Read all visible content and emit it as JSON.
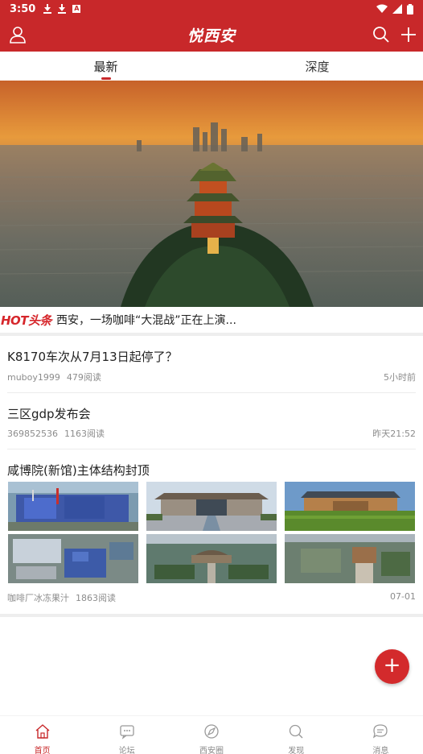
{
  "status_bar": {
    "time": "3:50",
    "battery_level": 0.9
  },
  "header": {
    "title": "悦西安",
    "icons": [
      "user-icon",
      "search-icon",
      "plus-icon"
    ],
    "color": "#c8282a"
  },
  "tabs": [
    {
      "label": "最新",
      "active": true
    },
    {
      "label": "深度",
      "active": false
    }
  ],
  "hot": {
    "tag": "HOT头条",
    "headline": "西安，一场咖啡“大混战”正在上演..."
  },
  "news": [
    {
      "title": "K8170车次从7月13日起停了？",
      "author": "muboy1999",
      "reads": "479阅读",
      "time": "5小时前"
    },
    {
      "title": "三区gdp发布会",
      "author": "369852536",
      "reads": "1163阅读",
      "time": "昨天21:52"
    },
    {
      "title": "咸博院(新馆)主体结构封顶",
      "author": "咖啡厂冰冻果汁",
      "reads": "1863阅读",
      "time": "07-01"
    }
  ],
  "fab": {
    "label": "+"
  },
  "bottom_nav": [
    {
      "label": "首页",
      "icon": "home-icon",
      "active": true
    },
    {
      "label": "论坛",
      "icon": "chat-icon",
      "active": false
    },
    {
      "label": "西安圈",
      "icon": "compass-icon",
      "active": false
    },
    {
      "label": "发现",
      "icon": "search-icon",
      "active": false
    },
    {
      "label": "消息",
      "icon": "message-icon",
      "active": false
    }
  ],
  "accent_color": "#c8282a"
}
